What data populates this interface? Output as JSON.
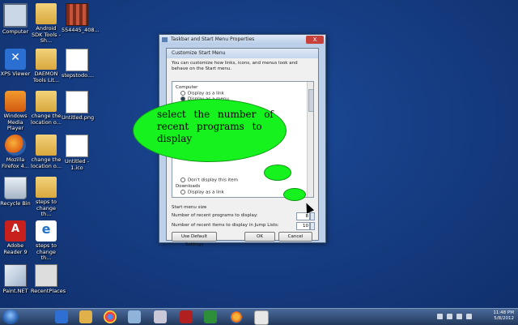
{
  "desktop_icons": [
    {
      "label": "Computer",
      "icon": "computer-icon"
    },
    {
      "label": "Android SDK Tools - Sh...",
      "icon": "folder-icon"
    },
    {
      "label": "554445_408...",
      "icon": "film-icon"
    },
    {
      "label": "XPS Viewer",
      "icon": "xps-viewer-icon"
    },
    {
      "label": "DAEMON Tools Lit...",
      "icon": "folder-icon"
    },
    {
      "label": "stepstodo....",
      "icon": "file-icon"
    },
    {
      "label": "Windows Media Player",
      "icon": "media-player-icon"
    },
    {
      "label": "change the location o...",
      "icon": "folder-icon"
    },
    {
      "label": "Untitled.png",
      "icon": "file-icon"
    },
    {
      "label": "Mozilla Firefox 4...",
      "icon": "firefox-icon"
    },
    {
      "label": "change the location o...",
      "icon": "folder-icon"
    },
    {
      "label": "Untitled - 1.ico",
      "icon": "file-icon"
    },
    {
      "label": "Recycle Bin",
      "icon": "recycle-bin-icon"
    },
    {
      "label": "steps to change th...",
      "icon": "folder-icon"
    },
    {
      "label": "Adobe Reader 9",
      "icon": "adobe-reader-icon"
    },
    {
      "label": "steps to change th...",
      "icon": "ie-icon"
    },
    {
      "label": "Paint.NET",
      "icon": "paint-net-icon"
    },
    {
      "label": "RecentPlaces",
      "icon": "shortcut-icon"
    }
  ],
  "outer_window": {
    "title": "Taskbar and Start Menu Properties",
    "close": "X"
  },
  "dialog": {
    "title": "Customize Start Menu",
    "description": "You can customize how links, icons, and menus look and behave on the Start menu.",
    "list_items": [
      {
        "text": "Computer",
        "type": "header"
      },
      {
        "text": "Display as a link",
        "type": "radio",
        "selected": false
      },
      {
        "text": "Display as a menu",
        "type": "radio",
        "selected": true
      },
      {
        "text": "Don't display this item",
        "type": "radio",
        "selected": false
      },
      {
        "text": "Downloads",
        "type": "header"
      },
      {
        "text": "Display as a link",
        "type": "radio",
        "selected": false
      }
    ],
    "size_section": "Start menu size",
    "recent_programs_label": "Number of recent programs to display:",
    "recent_programs_value": "8",
    "jumplist_label": "Number of recent items to display in Jump Lists:",
    "jumplist_value": "10",
    "default_button": "Use Default Settings",
    "ok_button": "OK",
    "cancel_button": "Cancel"
  },
  "callout": {
    "text": "select the number of recent programs to display",
    "color": "#15f21d"
  },
  "tray": {
    "time": "11:48 PM",
    "date": "5/8/2012"
  }
}
